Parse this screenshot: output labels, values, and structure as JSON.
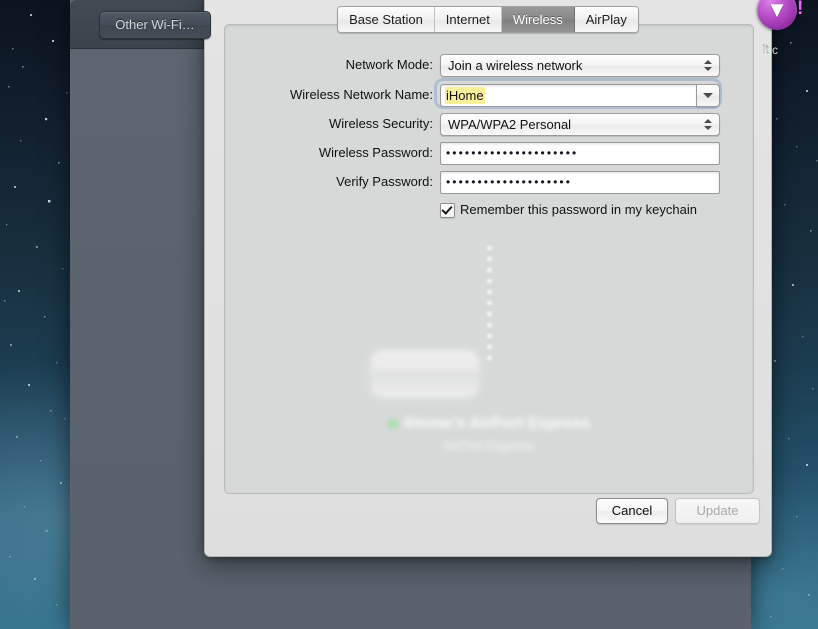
{
  "desktop": {
    "wallpaper_top_color": "#0b1420",
    "wallpaper_bottom_color": "#2e6d88"
  },
  "parent_window": {
    "background_color": "#5a636e",
    "other_button_label": "Other Wi-Fi…",
    "badge_glyph": "▼",
    "badge_color": "#b349c4",
    "badge_exclaim": "!",
    "clipped_text": "It\nc"
  },
  "sheet": {
    "tabs": [
      {
        "label": "Base Station",
        "selected": false
      },
      {
        "label": "Internet",
        "selected": false
      },
      {
        "label": "Wireless",
        "selected": true
      },
      {
        "label": "AirPlay",
        "selected": false
      }
    ],
    "form": {
      "network_mode": {
        "label": "Network Mode:",
        "value": "Join a wireless network",
        "control": "popup-button"
      },
      "wireless_network_name": {
        "label": "Wireless Network Name:",
        "value": "iHome",
        "control": "combo-box",
        "highlight_color": "#fbf09a",
        "focused": true
      },
      "wireless_security": {
        "label": "Wireless Security:",
        "value": "WPA/WPA2 Personal",
        "control": "popup-button"
      },
      "wireless_password": {
        "label": "Wireless Password:",
        "value": "•••••••••••••••••••••",
        "control": "secure-text-field"
      },
      "verify_password": {
        "label": "Verify Password:",
        "value": "••••••••••••••••••••",
        "control": "secure-text-field"
      },
      "remember_password": {
        "label": "Remember this password in my keychain",
        "checked": true,
        "control": "checkbox"
      }
    },
    "device": {
      "name": "iHome's AirPort Express",
      "subtitle": "AirPort Express",
      "status_color": "#9fe0a4"
    },
    "footer": {
      "cancel_label": "Cancel",
      "update_label": "Update",
      "update_enabled": false
    }
  }
}
